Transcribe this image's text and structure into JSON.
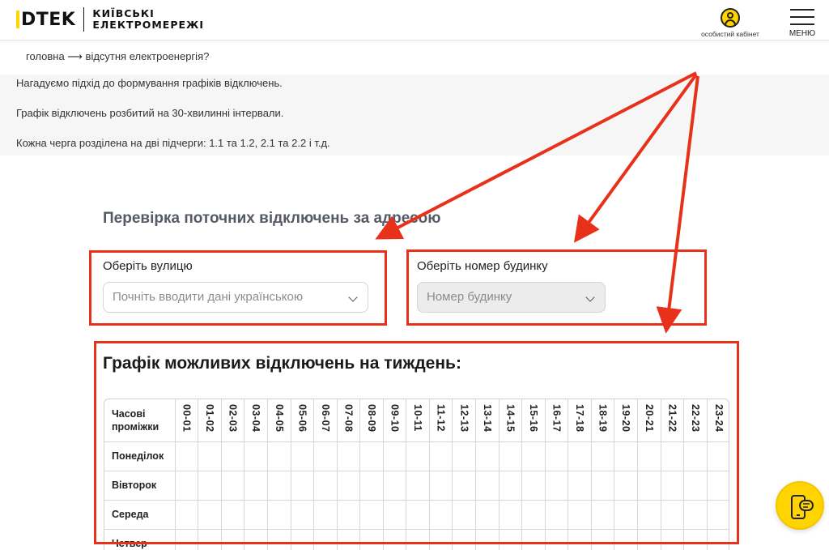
{
  "header": {
    "logo_mark": "DTEK",
    "logo_line1": "КИЇВСЬКІ",
    "logo_line2": "ЕЛЕКТРОМЕРЕЖІ",
    "cabinet_label": "особистий кабінет",
    "menu_label": "МЕНЮ"
  },
  "breadcrumb": "головна ⟶ відсутня електроенергія?",
  "info": [
    "Нагадуємо підхід до формування графіків відключень.",
    "Графік відключень розбитий на 30-хвилинні інтервали.",
    "Кожна черга розділена на дві підчерги: 1.1 та 1.2, 2.1 та 2.2 і т.д."
  ],
  "address_check": {
    "title": "Перевірка поточних відключень за адресою",
    "street_label": "Оберіть вулицю",
    "street_placeholder": "Почніть вводити дані українською",
    "house_label": "Оберіть номер будинку",
    "house_placeholder": "Номер будинку"
  },
  "schedule": {
    "title": "Графік можливих відключень на тиждень:",
    "corner_label": "Часові проміжки",
    "hours": [
      "00-01",
      "01-02",
      "02-03",
      "03-04",
      "04-05",
      "05-06",
      "06-07",
      "07-08",
      "08-09",
      "09-10",
      "10-11",
      "11-12",
      "12-13",
      "13-14",
      "14-15",
      "15-16",
      "16-17",
      "17-18",
      "18-19",
      "19-20",
      "20-21",
      "21-22",
      "22-23",
      "23-24"
    ],
    "days": [
      "Понеділок",
      "Вівторок",
      "Середа",
      "Четвер"
    ]
  },
  "colors": {
    "accent": "#ffd400",
    "annotation": "#e8311a"
  },
  "icons": {
    "cabinet": "user-circle-icon",
    "menu": "hamburger-icon",
    "dropdown": "chevron-down-icon",
    "chat": "phone-chat-icon"
  }
}
